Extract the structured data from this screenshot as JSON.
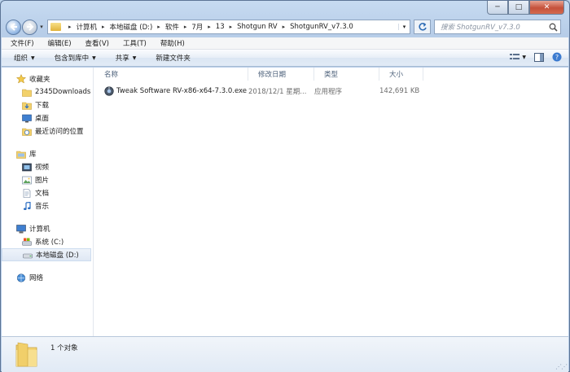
{
  "window": {
    "caption": {
      "minimize": "─",
      "maximize": "□",
      "close": "✕"
    }
  },
  "address": {
    "crumbs": [
      "计算机",
      "本地磁盘 (D:)",
      "软件",
      "7月",
      "13",
      "Shotgun RV",
      "ShotgunRV_v7.3.0"
    ]
  },
  "search": {
    "placeholder": "搜索 ShotgunRV_v7.3.0"
  },
  "menu": [
    "文件(F)",
    "编辑(E)",
    "查看(V)",
    "工具(T)",
    "帮助(H)"
  ],
  "commands": {
    "organize": "组织",
    "include": "包含到库中",
    "share": "共享",
    "new_folder": "新建文件夹"
  },
  "nav": {
    "favorites": {
      "label": "收藏夹",
      "items": [
        "2345Downloads",
        "下载",
        "桌面",
        "最近访问的位置"
      ]
    },
    "libraries": {
      "label": "库",
      "items": [
        "视频",
        "图片",
        "文档",
        "音乐"
      ]
    },
    "computer": {
      "label": "计算机",
      "items": [
        "系统 (C:)",
        "本地磁盘 (D:)"
      ]
    },
    "network": {
      "label": "网络"
    }
  },
  "columns": [
    "名称",
    "修改日期",
    "类型",
    "大小"
  ],
  "files": [
    {
      "name": "Tweak Software RV-x86-x64-7.3.0.exe",
      "modified": "2018/12/1 星期...",
      "type": "应用程序",
      "size": "142,691 KB"
    }
  ],
  "details": {
    "count": "1 个对象"
  }
}
